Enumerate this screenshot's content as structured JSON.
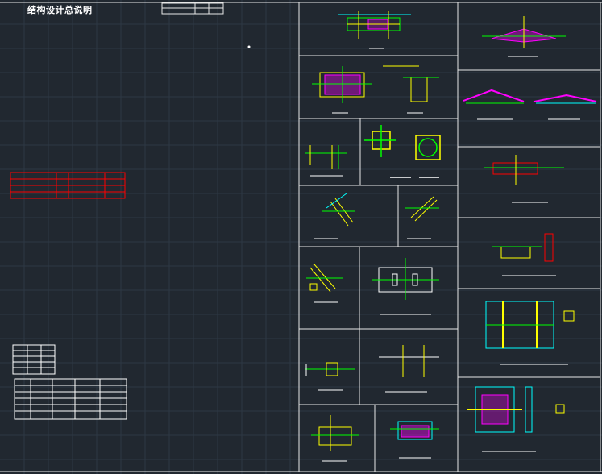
{
  "drawing": {
    "title": "结构设计总说明"
  },
  "colors": {
    "background": "#212830",
    "grid": "#2d3844",
    "frame": "#e8e8e8",
    "yellow": "#ffff00",
    "green": "#00ff00",
    "magenta": "#ff00ff",
    "cyan": "#00ffff",
    "red": "#ff0000",
    "white": "#ffffff"
  }
}
